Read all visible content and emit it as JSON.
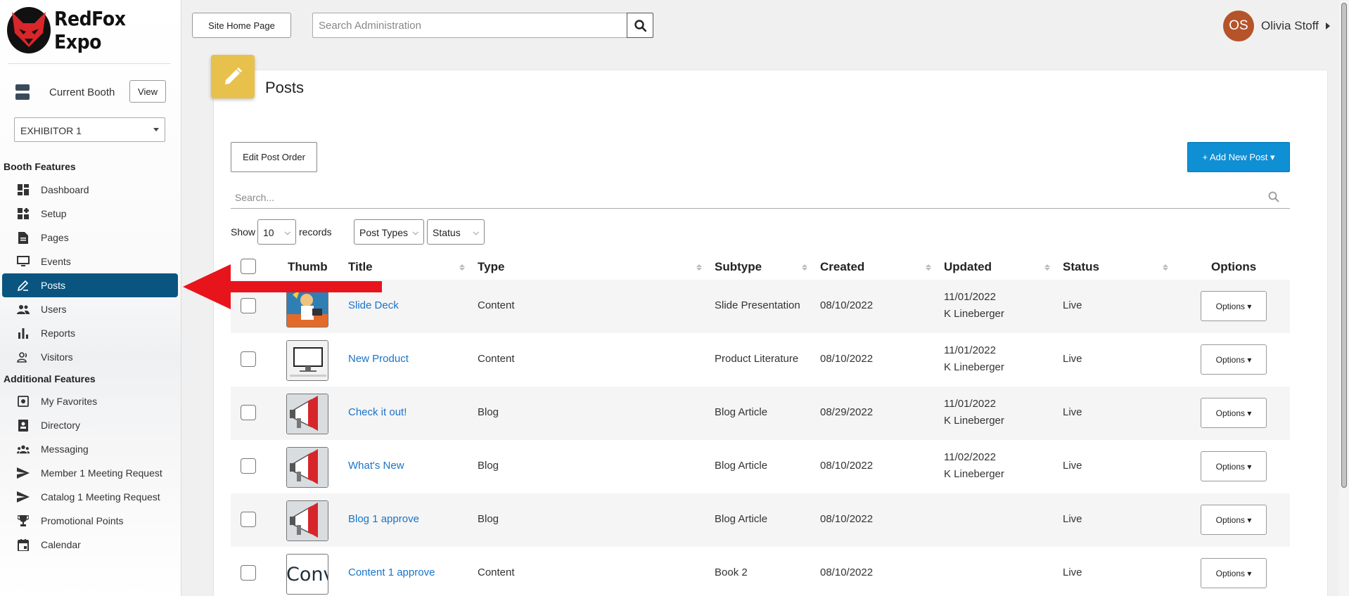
{
  "brand": {
    "name": "RedFox Expo"
  },
  "sidebar": {
    "current_booth_label": "Current Booth",
    "view_button": "View",
    "exhibitor_selected": "EXHIBITOR 1",
    "booth_features_heading": "Booth Features",
    "additional_features_heading": "Additional Features",
    "booth_items": [
      {
        "label": "Dashboard",
        "icon": "dashboard-icon"
      },
      {
        "label": "Setup",
        "icon": "setup-icon"
      },
      {
        "label": "Pages",
        "icon": "pages-icon"
      },
      {
        "label": "Events",
        "icon": "monitor-icon"
      },
      {
        "label": "Posts",
        "icon": "pencil-icon",
        "active": true
      },
      {
        "label": "Users",
        "icon": "users-icon"
      },
      {
        "label": "Reports",
        "icon": "bar-chart-icon"
      },
      {
        "label": "Visitors",
        "icon": "visitors-icon"
      }
    ],
    "additional_items": [
      {
        "label": "My Favorites",
        "icon": "favorites-icon"
      },
      {
        "label": "Directory",
        "icon": "directory-icon"
      },
      {
        "label": "Messaging",
        "icon": "messaging-icon"
      },
      {
        "label": "Member 1 Meeting Request",
        "icon": "send-icon"
      },
      {
        "label": "Catalog 1 Meeting Request",
        "icon": "send-icon"
      },
      {
        "label": "Promotional Points",
        "icon": "trophy-icon"
      },
      {
        "label": "Calendar",
        "icon": "calendar-icon"
      }
    ]
  },
  "topbar": {
    "site_home_button": "Site Home Page",
    "search_placeholder": "Search Administration",
    "user_initials": "OS",
    "user_name": "Olivia Stoff",
    "avatar_color": "#b5532a"
  },
  "page": {
    "title": "Posts",
    "edit_order_button": "Edit Post Order",
    "add_new_button": "+ Add New Post ▾",
    "search_placeholder": "Search...",
    "show_label": "Show",
    "records_per_page": "10",
    "records_label": "records",
    "post_types_filter": "Post Types",
    "status_filter": "Status"
  },
  "table": {
    "columns": {
      "thumb": "Thumb",
      "title": "Title",
      "type": "Type",
      "subtype": "Subtype",
      "created": "Created",
      "updated": "Updated",
      "status": "Status",
      "options": "Options"
    },
    "rows": [
      {
        "thumb": "slide-deck-thumbnail",
        "title": "Slide Deck",
        "type": "Content",
        "subtype": "Slide Presentation",
        "created": "08/10/2022",
        "updated_date": "11/01/2022",
        "updated_by": "K Lineberger",
        "status": "Live",
        "options": "Options ▾"
      },
      {
        "thumb": "monitor-thumbnail",
        "title": "New Product",
        "type": "Content",
        "subtype": "Product Literature",
        "created": "08/10/2022",
        "updated_date": "11/01/2022",
        "updated_by": "K Lineberger",
        "status": "Live",
        "options": "Options ▾"
      },
      {
        "thumb": "megaphone-thumbnail",
        "title": "Check it out!",
        "type": "Blog",
        "subtype": "Blog Article",
        "created": "08/29/2022",
        "updated_date": "11/01/2022",
        "updated_by": "K Lineberger",
        "status": "Live",
        "options": "Options ▾"
      },
      {
        "thumb": "megaphone-thumbnail",
        "title": "What's New",
        "type": "Blog",
        "subtype": "Blog Article",
        "created": "08/10/2022",
        "updated_date": "11/02/2022",
        "updated_by": "K Lineberger",
        "status": "Live",
        "options": "Options ▾"
      },
      {
        "thumb": "megaphone-thumbnail",
        "title": "Blog 1 approve",
        "type": "Blog",
        "subtype": "Blog Article",
        "created": "08/10/2022",
        "updated_date": "",
        "updated_by": "",
        "status": "Live",
        "options": "Options ▾"
      },
      {
        "thumb": "conv-text-thumbnail",
        "thumb_text": "Conv",
        "title": "Content 1 approve",
        "type": "Content",
        "subtype": "Book 2",
        "created": "08/10/2022",
        "updated_date": "",
        "updated_by": "",
        "status": "Live",
        "options": "Options ▾"
      }
    ]
  },
  "colors": {
    "active_nav": "#0a5580",
    "primary_button": "#0f8fd4",
    "link": "#1a73c8",
    "page_icon": "#e8c14d",
    "annotation_arrow": "#e8141c"
  }
}
